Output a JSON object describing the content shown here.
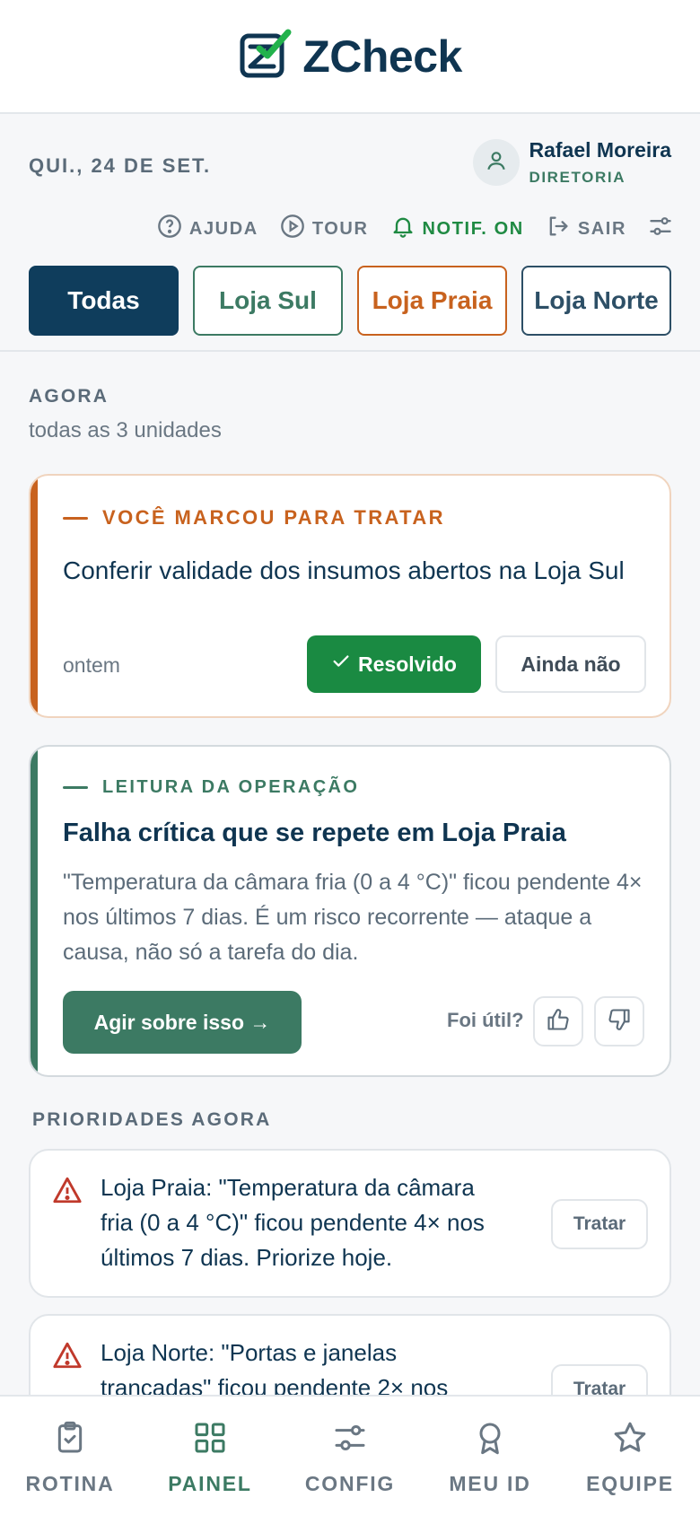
{
  "app": {
    "name": "ZCheck",
    "colors": {
      "brand": "#0f3551",
      "accent": "#3c7a63",
      "check": "#22b24c",
      "warning": "#c8621e",
      "danger": "#c0392b"
    }
  },
  "date": "QUI., 24 DE SET.",
  "user": {
    "name": "Rafael Moreira",
    "role": "DIRETORIA",
    "icon": "user-icon"
  },
  "actions": [
    {
      "label": "AJUDA",
      "icon": "help-circle-icon"
    },
    {
      "label": "TOUR",
      "icon": "play-circle-icon"
    },
    {
      "label": "NOTIF. ON",
      "icon": "bell-icon"
    },
    {
      "label": "SAIR",
      "icon": "logout-icon"
    }
  ],
  "stores": [
    {
      "label": "Todas",
      "active": true
    },
    {
      "label": "Loja Sul"
    },
    {
      "label": "Loja Praia"
    },
    {
      "label": "Loja Norte"
    }
  ],
  "section": {
    "label": "AGORA",
    "sub": "todas as 3 unidades"
  },
  "marked": {
    "eyebrow": "VOCÊ MARCOU PARA TRATAR",
    "text": "Conferir validade dos insumos abertos na Loja Sul",
    "when": "ontem",
    "resolve_label": "Resolvido",
    "not_yet_label": "Ainda não"
  },
  "insight": {
    "eyebrow": "LEITURA DA OPERAÇÃO",
    "title": "Falha crítica que se repete em Loja Praia",
    "body": "\"Temperatura da câmara fria (0 a 4 °C)\" ficou pendente 4× nos últimos 7 dias. É um risco recorrente — ataque a causa, não só a tarefa do dia.",
    "action_label": "Agir sobre isso →",
    "useful_label": "Foi útil?"
  },
  "priorities": {
    "label": "PRIORIDADES AGORA",
    "items": [
      {
        "text": "Loja Praia: \"Temperatura da câmara fria (0 a 4 °C)\" ficou pendente 4× nos últimos 7 dias. Priorize hoje.",
        "button": "Tratar"
      },
      {
        "text": "Loja Norte: \"Portas e janelas trancadas\" ficou pendente 2× nos",
        "button": "Tratar"
      }
    ]
  },
  "nav": [
    {
      "label": "ROTINA",
      "icon": "clipboard-check-icon"
    },
    {
      "label": "PAINEL",
      "icon": "grid-icon",
      "active": true
    },
    {
      "label": "CONFIG",
      "icon": "sliders-icon"
    },
    {
      "label": "MEU ID",
      "icon": "badge-icon"
    },
    {
      "label": "EQUIPE",
      "icon": "star-icon"
    }
  ]
}
